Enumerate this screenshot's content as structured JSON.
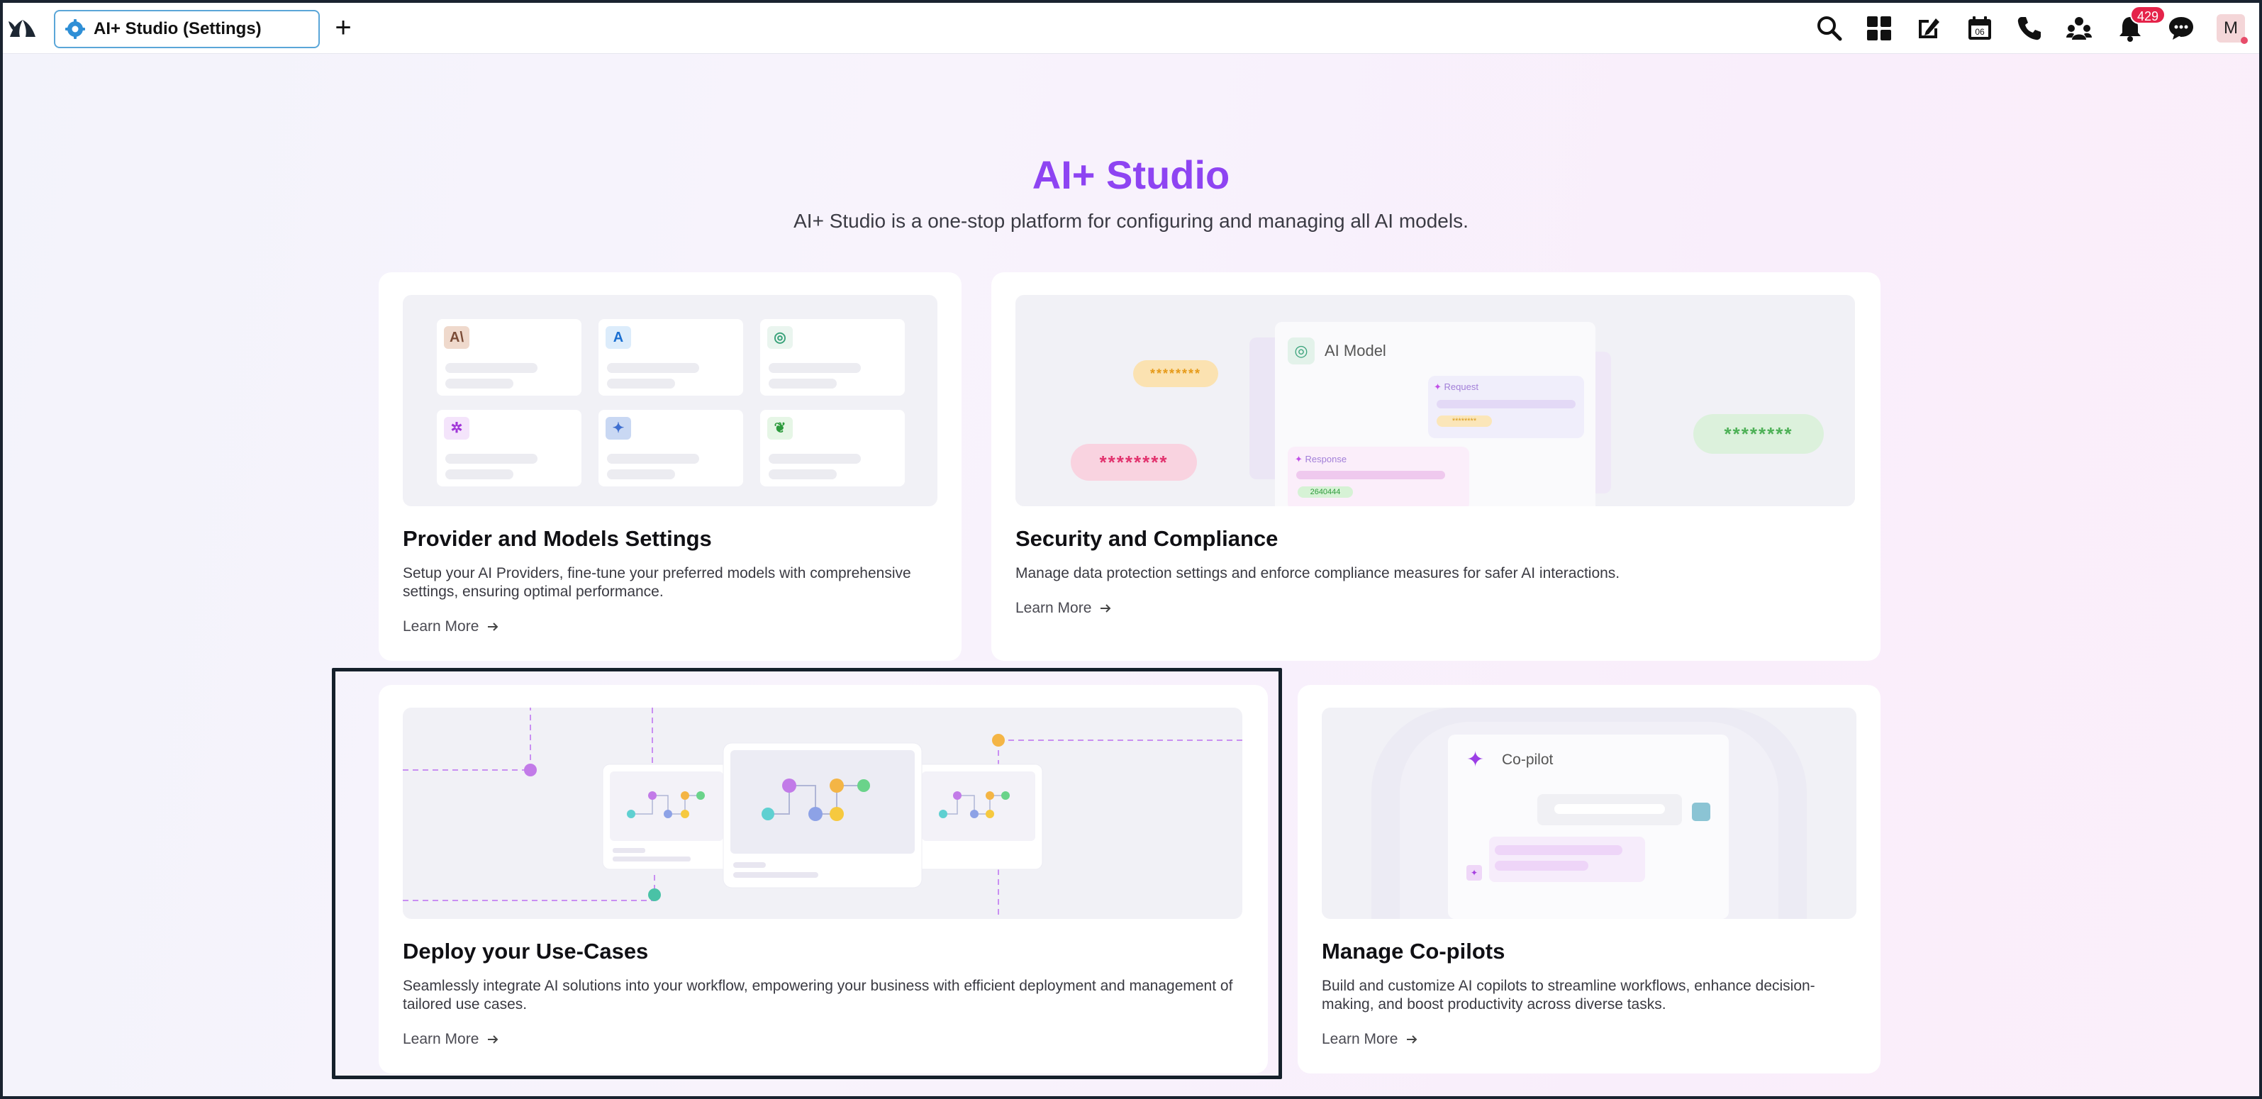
{
  "topbar": {
    "tab_label": "AI+ Studio (Settings)",
    "add_tab": "+",
    "calendar_day": "06",
    "notification_count": "429",
    "avatar_initial": "M"
  },
  "hero": {
    "title": "AI+ Studio",
    "subtitle": "AI+ Studio is a one-stop platform for configuring and managing all AI models."
  },
  "cards": {
    "providers": {
      "title": "Provider and Models Settings",
      "description": "Setup your AI Providers, fine-tune your preferred models with comprehensive settings, ensuring optimal performance.",
      "link": "Learn More"
    },
    "security": {
      "title": "Security and Compliance",
      "description": "Manage data protection settings and enforce compliance measures for safer AI interactions.",
      "link": "Learn More",
      "illustration": {
        "model_label": "AI Model",
        "request_label": "Request",
        "response_label": "Response",
        "mask_orange": "********",
        "mask_pink": "********",
        "mask_green": "********",
        "mask_small": "********",
        "response_value": "2640444"
      }
    },
    "usecases": {
      "title": "Deploy your Use-Cases",
      "description": "Seamlessly integrate AI solutions into your workflow, empowering your business with efficient deployment and management of tailored use cases.",
      "link": "Learn More"
    },
    "copilots": {
      "title": "Manage Co-pilots",
      "description": "Build and customize AI copilots to streamline workflows, enhance decision-making, and boost productivity across diverse tasks.",
      "link": "Learn More",
      "illustration": {
        "label": "Co-pilot"
      }
    }
  },
  "colors": {
    "accent": "#8e44f2",
    "badge": "#e5234a",
    "tab_border": "#5aa6d8"
  },
  "icons": [
    "logo-icon",
    "gear-icon",
    "search-icon",
    "apps-grid-icon",
    "compose-icon",
    "calendar-icon",
    "phone-icon",
    "team-icon",
    "bell-icon",
    "chat-icon",
    "arrow-right-icon"
  ]
}
